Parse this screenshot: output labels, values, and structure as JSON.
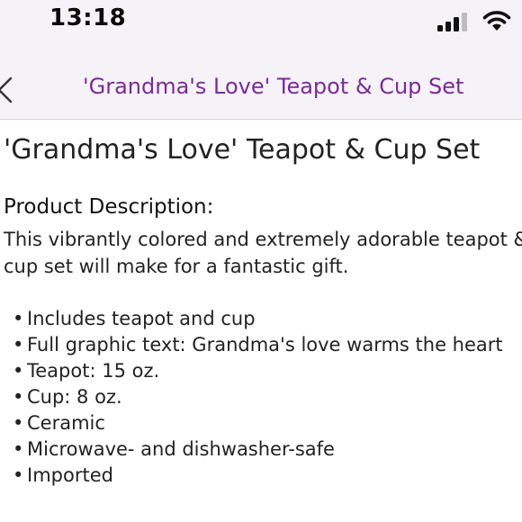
{
  "status_bar": {
    "time": "13:18",
    "icons": [
      "cellular-signal-icon",
      "wifi-icon"
    ]
  },
  "nav": {
    "title": "'Grandma's Love' Teapot & Cup Set",
    "title_color": "#7b2a9c",
    "back_icon": "chevron-left-icon"
  },
  "product": {
    "title": "'Grandma's Love' Teapot & Cup Set",
    "description_heading": "Product Description:",
    "description_lines": [
      "This vibrantly colored and extremely adorable teapot &",
      "cup set will make for a fantastic gift."
    ],
    "bullet_char": "•",
    "features": [
      "Includes teapot and cup",
      "Full graphic text: Grandma's love warms the heart",
      "Teapot: 15 oz.",
      "Cup: 8 oz.",
      "Ceramic",
      "Microwave- and dishwasher-safe",
      "Imported"
    ]
  }
}
